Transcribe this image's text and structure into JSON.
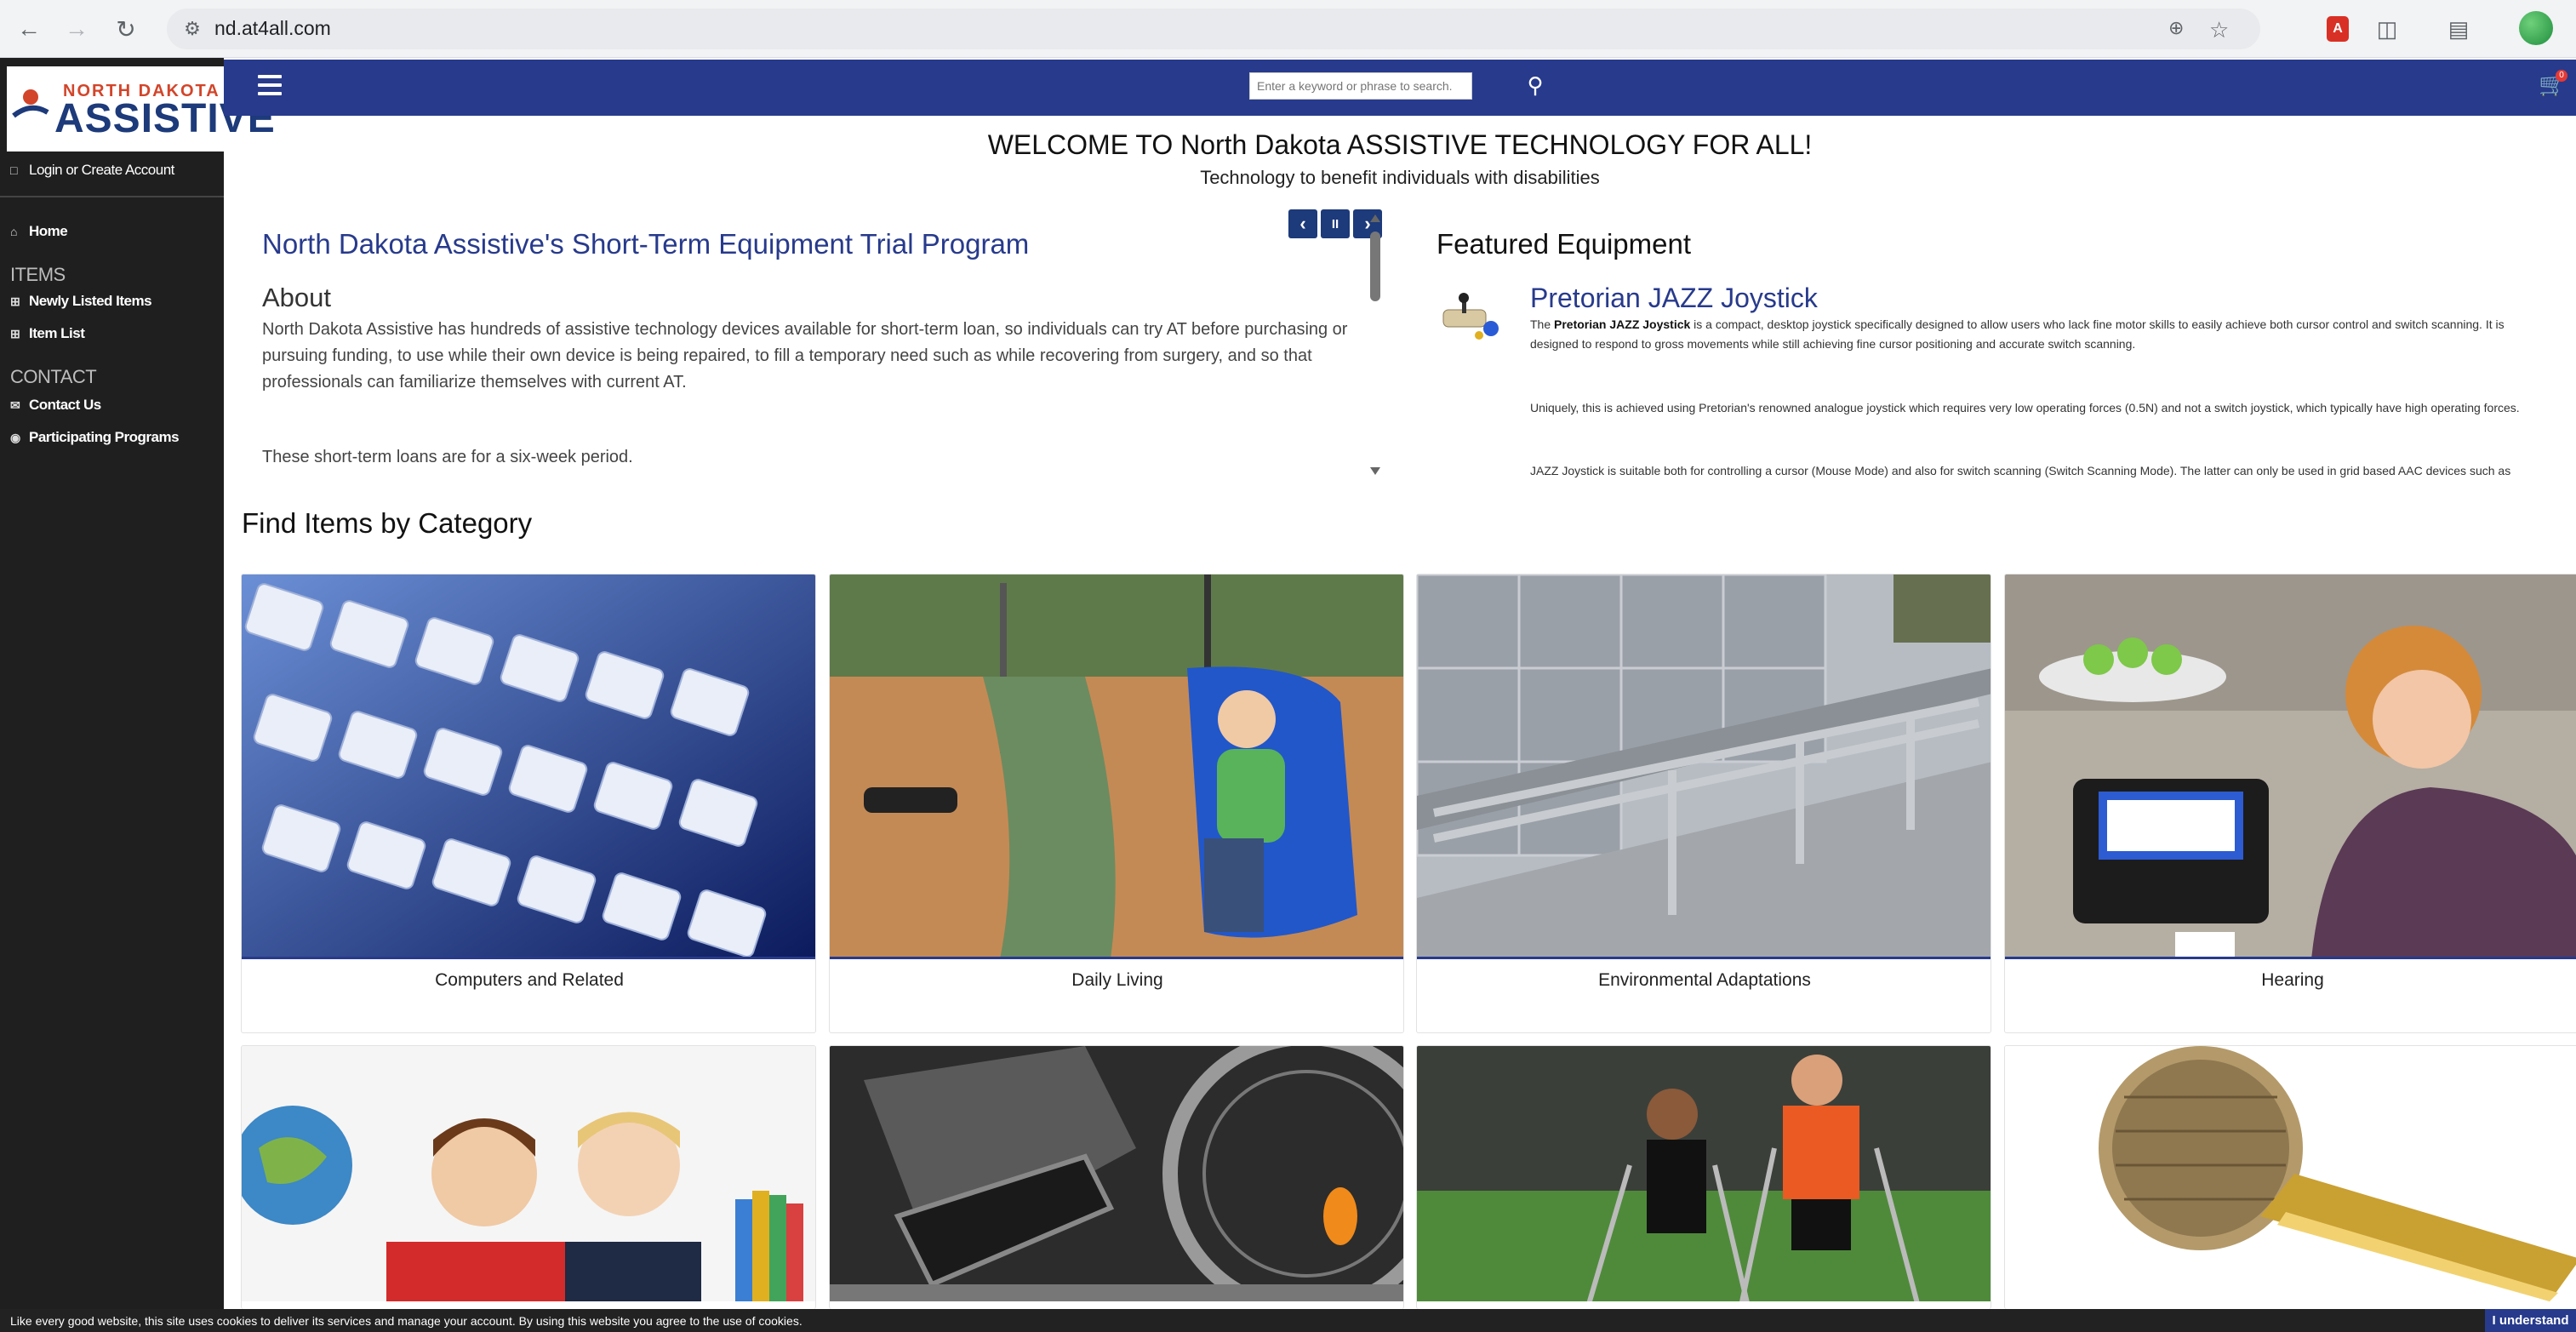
{
  "browser": {
    "url": "nd.at4all.com",
    "back_icon": "arrow-left-icon",
    "forward_icon": "arrow-right-icon",
    "reload_icon": "reload-icon"
  },
  "brand": {
    "logo_top": "NORTH DAKOTA",
    "logo_main": "ASSISTIVE",
    "primary_color": "#273a8c",
    "accent_color": "#d2452a"
  },
  "sidebar": {
    "login": "Login or Create Account",
    "home": "Home",
    "items_heading": "ITEMS",
    "newly_listed": "Newly Listed Items",
    "item_list": "Item List",
    "contact_heading": "CONTACT",
    "contact_us": "Contact Us",
    "participating": "Participating Programs"
  },
  "topbar": {
    "search_placeholder": "Enter a keyword or phrase to search.",
    "cart_count": "0"
  },
  "welcome": {
    "title": "WELCOME TO North Dakota ASSISTIVE TECHNOLOGY FOR ALL!",
    "subtitle": "Technology to benefit individuals with disabilities"
  },
  "program": {
    "title": "North Dakota Assistive's Short-Term Equipment Trial Program",
    "about_heading": "About",
    "about_text": "North Dakota Assistive has hundreds of assistive technology devices available for short-term loan, so individuals can try AT before purchasing or pursuing funding, to use while their own device is being repaired, to fill a temporary need such as while recovering from surgery, and so that professionals can familiarize themselves with current AT.",
    "loan_text": "These short-term loans are for a six-week period.",
    "prev_label": "‹",
    "pause_label": "II",
    "next_label": "›"
  },
  "featured": {
    "heading": "Featured Equipment",
    "product_title": "Pretorian JAZZ Joystick",
    "p1_lead": "The ",
    "p1_bold": "Pretorian JAZZ Joystick",
    "p1_rest": " is a compact, desktop joystick specifically designed to allow users who lack fine motor skills to easily achieve both cursor control and switch scanning. It is designed to respond to gross movements while still achieving fine cursor positioning and accurate switch scanning.",
    "p2": "Uniquely, this is achieved using Pretorian's renowned analogue joystick which requires very low operating forces (0.5N) and not a switch joystick, which typically have high operating forces.",
    "p3": "JAZZ Joystick is suitable both for controlling a cursor (Mouse Mode) and also for switch scanning (Switch Scanning Mode). The latter can only be used in grid based AAC devices such as"
  },
  "categories": {
    "heading": "Find Items by Category",
    "items": [
      {
        "label": "Computers and Related"
      },
      {
        "label": "Daily Living"
      },
      {
        "label": "Environmental Adaptations"
      },
      {
        "label": "Hearing"
      }
    ]
  },
  "cookie": {
    "text": "Like every good website, this site uses cookies to deliver its services and manage your account. By using this website you agree to the use of cookies.",
    "button": "I understand"
  }
}
